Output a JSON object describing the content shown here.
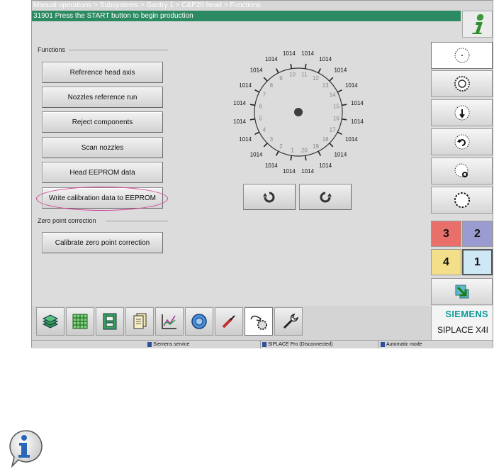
{
  "breadcrumb": "Manual operations > Subsystems > Gantry 1 > C&P20 head > Functions",
  "status_message": "31901 Press the START button to begin production",
  "functions": {
    "section_title": "Functions",
    "buttons": [
      "Reference head axis",
      "Nozzles reference run",
      "Reject components",
      "Scan nozzles",
      "Head EEPROM data",
      "Write calibration data to EEPROM"
    ]
  },
  "zero_point": {
    "section_title": "Zero point correction",
    "button": "Calibrate zero point correction"
  },
  "dial": {
    "numbers": [
      "1",
      "2",
      "3",
      "4",
      "5",
      "6",
      "7",
      "8",
      "9",
      "10",
      "11",
      "12",
      "13",
      "14",
      "15",
      "16",
      "17",
      "18",
      "19",
      "20"
    ],
    "values": [
      "1014",
      "1014",
      "1014",
      "1014",
      "1014",
      "1014",
      "1014",
      "1014",
      "1014",
      "1014",
      "1014",
      "1014",
      "1014",
      "1014",
      "1014",
      "1014",
      "1014",
      "1014",
      "1014",
      "1014"
    ]
  },
  "rotate_buttons": {
    "left_icon": "rotate-left-icon",
    "right_icon": "rotate-right-icon"
  },
  "side_toolbar": {
    "icons": [
      "dial-view-icon",
      "gear-detail-icon",
      "head-down-icon",
      "head-rotate-icon",
      "head-search-icon",
      "head-settings-icon"
    ],
    "gantries": [
      {
        "label": "3",
        "color": "#e9706a"
      },
      {
        "label": "2",
        "color": "#9a9bd1"
      },
      {
        "label": "4",
        "color": "#f3df8a"
      },
      {
        "label": "1",
        "color": "#cfe8f5"
      }
    ],
    "exit_icon": "exit-arrow-icon"
  },
  "bottom_toolbar": {
    "icons": [
      "stack-icon",
      "grid-icon",
      "board-icon",
      "documents-icon",
      "chart-icon",
      "camera-icon",
      "tool-icon",
      "hand-gear-icon",
      "wrench-icon"
    ]
  },
  "brand": {
    "company": "SIEMENS",
    "model": "SIPLACE X4I"
  },
  "footer": {
    "user": "Siemens service",
    "connection": "SIPLACE Pro (Disconnected)",
    "mode": "Automatic mode"
  },
  "colors": {
    "status_green": "#2c8a63",
    "highlight": "#d23f98",
    "brand_teal": "#0b9a9a",
    "info_blue": "#2a66b8"
  }
}
